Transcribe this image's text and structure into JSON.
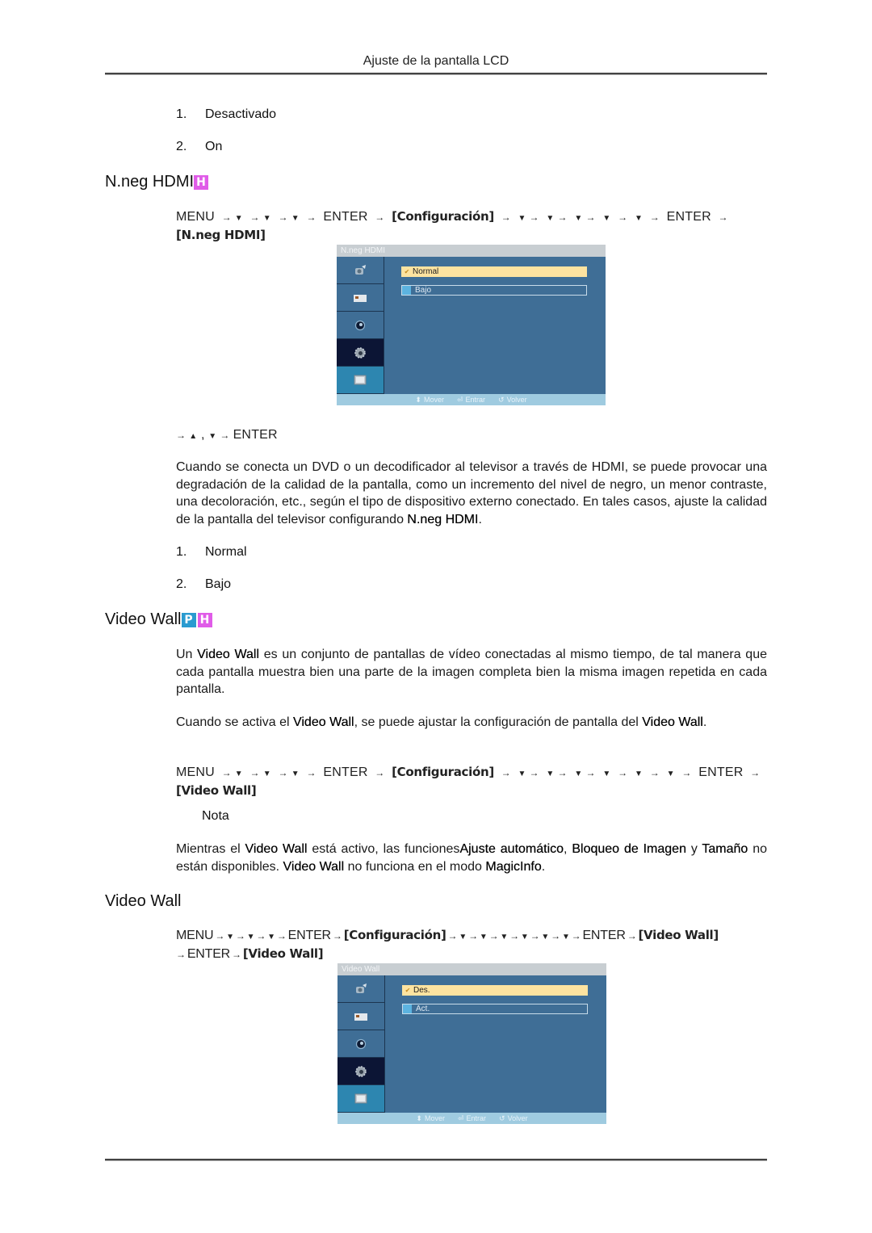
{
  "page": {
    "header_title": "Ajuste de la pantalla LCD"
  },
  "section_intro": {
    "list": [
      {
        "num": "1.",
        "label": "Desactivado"
      },
      {
        "num": "2.",
        "label": "On"
      }
    ]
  },
  "nneg": {
    "heading": "N.neg HDMI",
    "badges": [
      "H"
    ],
    "nav_path": {
      "menu": "MENU",
      "enter": "ENTER",
      "config": "[Configuración]",
      "target": "[N.neg HDMI]",
      "arrow": "→",
      "down": "▼",
      "up": "▲"
    },
    "osd": {
      "title": "N.neg HDMI",
      "options": [
        {
          "label": "Normal",
          "selected": true
        },
        {
          "label": "Bajo",
          "selected": false
        }
      ],
      "footer": [
        {
          "icon": "updown-icon",
          "label": "Mover"
        },
        {
          "icon": "enter-icon",
          "label": "Entrar"
        },
        {
          "icon": "return-icon",
          "label": "Volver"
        }
      ],
      "tabs": [
        "picture-icon",
        "sound-icon",
        "setup-icon",
        "configuration-icon",
        "multi-control-icon"
      ],
      "active_tab": 3
    },
    "after_nav": "ENTER",
    "description": {
      "text": "Cuando se conecta un DVD o un decodificador al televisor a través de HDMI, se puede provocar una degradación de la calidad de la pantalla, como un incremento del nivel de negro, un menor contraste, una decoloración, etc., según el tipo de dispositivo externo conectado. En tales casos, ajuste la calidad de la pantalla del televisor configurando ",
      "bold": "N.neg HDMI",
      "end": "."
    },
    "list": [
      {
        "num": "1.",
        "label": "Normal"
      },
      {
        "num": "2.",
        "label": "Bajo"
      }
    ]
  },
  "videowall": {
    "heading": "Video Wall",
    "badges": [
      "P",
      "H"
    ],
    "p1": {
      "a": "Un ",
      "b": "Video Wall",
      "c": " es un conjunto de pantallas de vídeo conectadas al mismo tiempo, de tal manera que cada pantalla muestra bien una parte de la imagen completa bien la misma imagen repetida en cada pantalla."
    },
    "p2": {
      "a": "Cuando se activa el ",
      "b": "Video Wall",
      "c": ", se puede ajustar la configuración de pantalla del ",
      "d": "Video Wall",
      "e": "."
    },
    "nav_target": "[Video Wall]",
    "note_title": "Nota",
    "note": {
      "a": "Mientras el ",
      "b": "Video Wall",
      "c": " está activo, las funciones",
      "d": "Ajuste automático",
      "e": ", ",
      "f": "Bloqueo de Imagen",
      "g": " y ",
      "h": "Tamaño",
      "i": " no están disponibles. ",
      "j": "Video Wall",
      "k": " no funciona en el modo ",
      "l": "MagicInfo",
      "m": "."
    }
  },
  "videowall2": {
    "heading": "Video Wall",
    "nav_target": "[Video Wall]",
    "osd": {
      "title": "Video Wall",
      "options": [
        {
          "label": "Des.",
          "selected": true
        },
        {
          "label": "Act.",
          "selected": false
        }
      ],
      "footer": [
        {
          "icon": "updown-icon",
          "label": "Mover"
        },
        {
          "icon": "enter-icon",
          "label": "Entrar"
        },
        {
          "icon": "return-icon",
          "label": "Volver"
        }
      ],
      "active_tab": 3
    }
  }
}
